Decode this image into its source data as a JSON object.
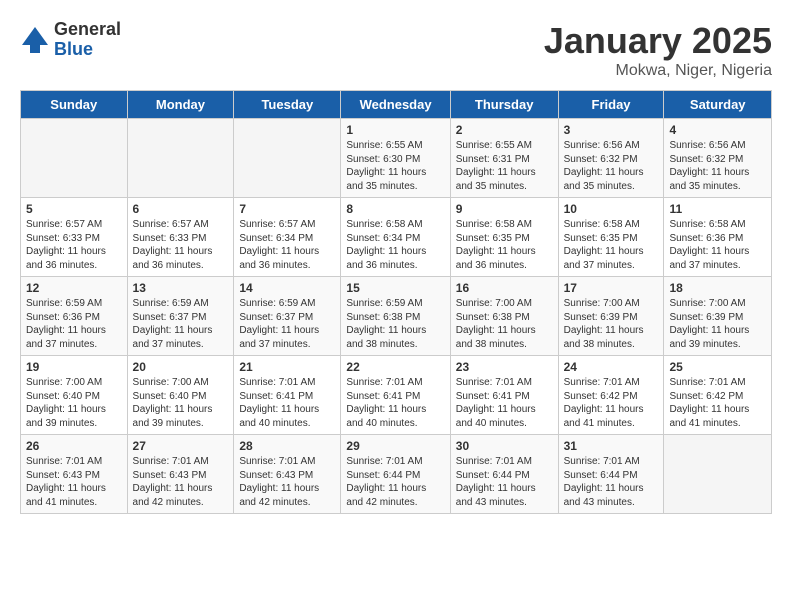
{
  "header": {
    "logo_general": "General",
    "logo_blue": "Blue",
    "title": "January 2025",
    "subtitle": "Mokwa, Niger, Nigeria"
  },
  "days_of_week": [
    "Sunday",
    "Monday",
    "Tuesday",
    "Wednesday",
    "Thursday",
    "Friday",
    "Saturday"
  ],
  "weeks": [
    [
      {
        "day": "",
        "sunrise": "",
        "sunset": "",
        "daylight": "",
        "empty": true
      },
      {
        "day": "",
        "sunrise": "",
        "sunset": "",
        "daylight": "",
        "empty": true
      },
      {
        "day": "",
        "sunrise": "",
        "sunset": "",
        "daylight": "",
        "empty": true
      },
      {
        "day": "1",
        "sunrise": "Sunrise: 6:55 AM",
        "sunset": "Sunset: 6:30 PM",
        "daylight": "Daylight: 11 hours and 35 minutes."
      },
      {
        "day": "2",
        "sunrise": "Sunrise: 6:55 AM",
        "sunset": "Sunset: 6:31 PM",
        "daylight": "Daylight: 11 hours and 35 minutes."
      },
      {
        "day": "3",
        "sunrise": "Sunrise: 6:56 AM",
        "sunset": "Sunset: 6:32 PM",
        "daylight": "Daylight: 11 hours and 35 minutes."
      },
      {
        "day": "4",
        "sunrise": "Sunrise: 6:56 AM",
        "sunset": "Sunset: 6:32 PM",
        "daylight": "Daylight: 11 hours and 35 minutes."
      }
    ],
    [
      {
        "day": "5",
        "sunrise": "Sunrise: 6:57 AM",
        "sunset": "Sunset: 6:33 PM",
        "daylight": "Daylight: 11 hours and 36 minutes."
      },
      {
        "day": "6",
        "sunrise": "Sunrise: 6:57 AM",
        "sunset": "Sunset: 6:33 PM",
        "daylight": "Daylight: 11 hours and 36 minutes."
      },
      {
        "day": "7",
        "sunrise": "Sunrise: 6:57 AM",
        "sunset": "Sunset: 6:34 PM",
        "daylight": "Daylight: 11 hours and 36 minutes."
      },
      {
        "day": "8",
        "sunrise": "Sunrise: 6:58 AM",
        "sunset": "Sunset: 6:34 PM",
        "daylight": "Daylight: 11 hours and 36 minutes."
      },
      {
        "day": "9",
        "sunrise": "Sunrise: 6:58 AM",
        "sunset": "Sunset: 6:35 PM",
        "daylight": "Daylight: 11 hours and 36 minutes."
      },
      {
        "day": "10",
        "sunrise": "Sunrise: 6:58 AM",
        "sunset": "Sunset: 6:35 PM",
        "daylight": "Daylight: 11 hours and 37 minutes."
      },
      {
        "day": "11",
        "sunrise": "Sunrise: 6:58 AM",
        "sunset": "Sunset: 6:36 PM",
        "daylight": "Daylight: 11 hours and 37 minutes."
      }
    ],
    [
      {
        "day": "12",
        "sunrise": "Sunrise: 6:59 AM",
        "sunset": "Sunset: 6:36 PM",
        "daylight": "Daylight: 11 hours and 37 minutes."
      },
      {
        "day": "13",
        "sunrise": "Sunrise: 6:59 AM",
        "sunset": "Sunset: 6:37 PM",
        "daylight": "Daylight: 11 hours and 37 minutes."
      },
      {
        "day": "14",
        "sunrise": "Sunrise: 6:59 AM",
        "sunset": "Sunset: 6:37 PM",
        "daylight": "Daylight: 11 hours and 37 minutes."
      },
      {
        "day": "15",
        "sunrise": "Sunrise: 6:59 AM",
        "sunset": "Sunset: 6:38 PM",
        "daylight": "Daylight: 11 hours and 38 minutes."
      },
      {
        "day": "16",
        "sunrise": "Sunrise: 7:00 AM",
        "sunset": "Sunset: 6:38 PM",
        "daylight": "Daylight: 11 hours and 38 minutes."
      },
      {
        "day": "17",
        "sunrise": "Sunrise: 7:00 AM",
        "sunset": "Sunset: 6:39 PM",
        "daylight": "Daylight: 11 hours and 38 minutes."
      },
      {
        "day": "18",
        "sunrise": "Sunrise: 7:00 AM",
        "sunset": "Sunset: 6:39 PM",
        "daylight": "Daylight: 11 hours and 39 minutes."
      }
    ],
    [
      {
        "day": "19",
        "sunrise": "Sunrise: 7:00 AM",
        "sunset": "Sunset: 6:40 PM",
        "daylight": "Daylight: 11 hours and 39 minutes."
      },
      {
        "day": "20",
        "sunrise": "Sunrise: 7:00 AM",
        "sunset": "Sunset: 6:40 PM",
        "daylight": "Daylight: 11 hours and 39 minutes."
      },
      {
        "day": "21",
        "sunrise": "Sunrise: 7:01 AM",
        "sunset": "Sunset: 6:41 PM",
        "daylight": "Daylight: 11 hours and 40 minutes."
      },
      {
        "day": "22",
        "sunrise": "Sunrise: 7:01 AM",
        "sunset": "Sunset: 6:41 PM",
        "daylight": "Daylight: 11 hours and 40 minutes."
      },
      {
        "day": "23",
        "sunrise": "Sunrise: 7:01 AM",
        "sunset": "Sunset: 6:41 PM",
        "daylight": "Daylight: 11 hours and 40 minutes."
      },
      {
        "day": "24",
        "sunrise": "Sunrise: 7:01 AM",
        "sunset": "Sunset: 6:42 PM",
        "daylight": "Daylight: 11 hours and 41 minutes."
      },
      {
        "day": "25",
        "sunrise": "Sunrise: 7:01 AM",
        "sunset": "Sunset: 6:42 PM",
        "daylight": "Daylight: 11 hours and 41 minutes."
      }
    ],
    [
      {
        "day": "26",
        "sunrise": "Sunrise: 7:01 AM",
        "sunset": "Sunset: 6:43 PM",
        "daylight": "Daylight: 11 hours and 41 minutes."
      },
      {
        "day": "27",
        "sunrise": "Sunrise: 7:01 AM",
        "sunset": "Sunset: 6:43 PM",
        "daylight": "Daylight: 11 hours and 42 minutes."
      },
      {
        "day": "28",
        "sunrise": "Sunrise: 7:01 AM",
        "sunset": "Sunset: 6:43 PM",
        "daylight": "Daylight: 11 hours and 42 minutes."
      },
      {
        "day": "29",
        "sunrise": "Sunrise: 7:01 AM",
        "sunset": "Sunset: 6:44 PM",
        "daylight": "Daylight: 11 hours and 42 minutes."
      },
      {
        "day": "30",
        "sunrise": "Sunrise: 7:01 AM",
        "sunset": "Sunset: 6:44 PM",
        "daylight": "Daylight: 11 hours and 43 minutes."
      },
      {
        "day": "31",
        "sunrise": "Sunrise: 7:01 AM",
        "sunset": "Sunset: 6:44 PM",
        "daylight": "Daylight: 11 hours and 43 minutes."
      },
      {
        "day": "",
        "sunrise": "",
        "sunset": "",
        "daylight": "",
        "empty": true
      }
    ]
  ]
}
